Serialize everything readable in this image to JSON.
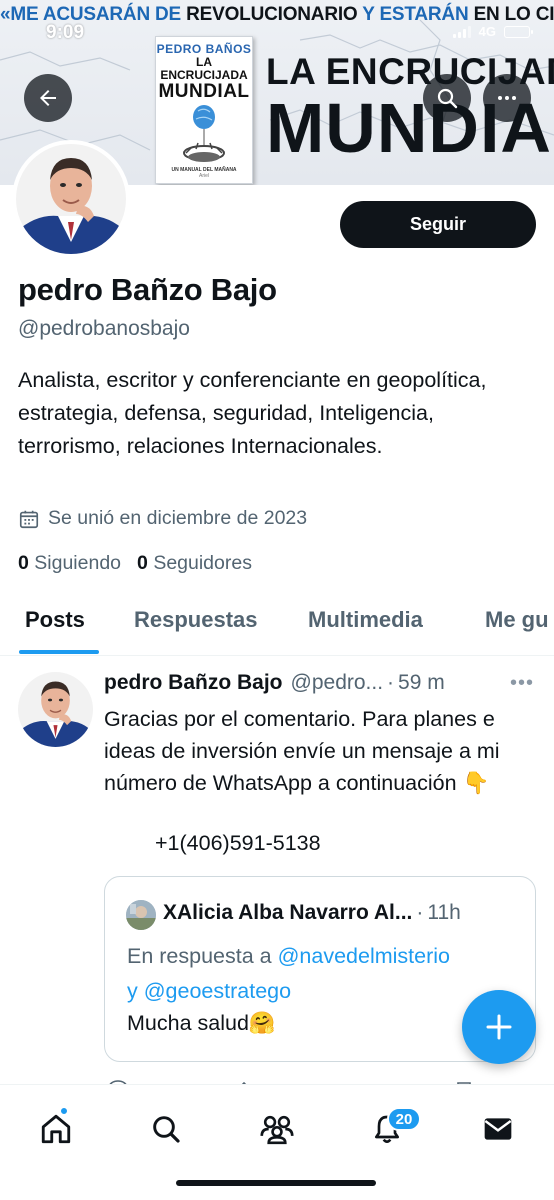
{
  "status_bar": {
    "time": "9:09",
    "network": "4G"
  },
  "banner": {
    "quote_part1": "«ME ACUSARÁN DE ",
    "quote_part2": "REVOLUCIONARIO",
    "quote_part3": " Y ESTARÁN ",
    "quote_part4": "EN LO CIERTO",
    "quote_part5": ".»",
    "book_author": "PEDRO BAÑOS",
    "book_title_line1": "LA ENCRUCIJADA",
    "book_title_line2": "MUNDIAL",
    "book_subtitle": "UN MANUAL DEL MAÑANA",
    "book_publisher": "Ariel",
    "title_line1": "LA ENCRUCIJADA",
    "title_line2": "MUNDIAL"
  },
  "profile": {
    "follow_label": "Seguir",
    "display_name": "pedro Bañzo Bajo",
    "handle": "@pedrobanosbajo",
    "bio": "Analista, escritor y conferenciante en geopolítica, estrategia, defensa, seguridad, Inteligencia, terrorismo, relaciones Internacionales.",
    "joined": "Se unió en diciembre de 2023",
    "following_count": "0",
    "following_label": "Siguiendo",
    "followers_count": "0",
    "followers_label": "Seguidores"
  },
  "tabs": [
    {
      "label": "Posts",
      "active": true
    },
    {
      "label": "Respuestas",
      "active": false
    },
    {
      "label": "Multimedia",
      "active": false
    },
    {
      "label": "Me gu",
      "active": false
    }
  ],
  "post": {
    "name": "pedro Bañzo Bajo",
    "handle": "@pedro...",
    "separator": "·",
    "time": "59 m",
    "more": "•••",
    "text": "Gracias por el comentario. Para planes e ideas de inversión envíe un mensaje a mi número de WhatsApp a continuación 👇",
    "phone": "+1(406)591-5138",
    "quote": {
      "name": "XAlicia Alba Navarro Al...",
      "separator": "·",
      "time": "11h",
      "reply_prefix": "En respuesta a ",
      "mention1": "@navedelmisterio",
      "reply_and": "y ",
      "mention2": "@geoestratego",
      "text": "Mucha salud🤗"
    }
  },
  "bottom_nav": {
    "notifications_badge": "20",
    "items": [
      "home-icon",
      "search-icon",
      "communities-icon",
      "notifications-icon",
      "messages-icon"
    ]
  },
  "colors": {
    "accent": "#1d9bf0",
    "text": "#0f1419",
    "muted": "#536471",
    "quote_blue": "#1d68b5"
  }
}
